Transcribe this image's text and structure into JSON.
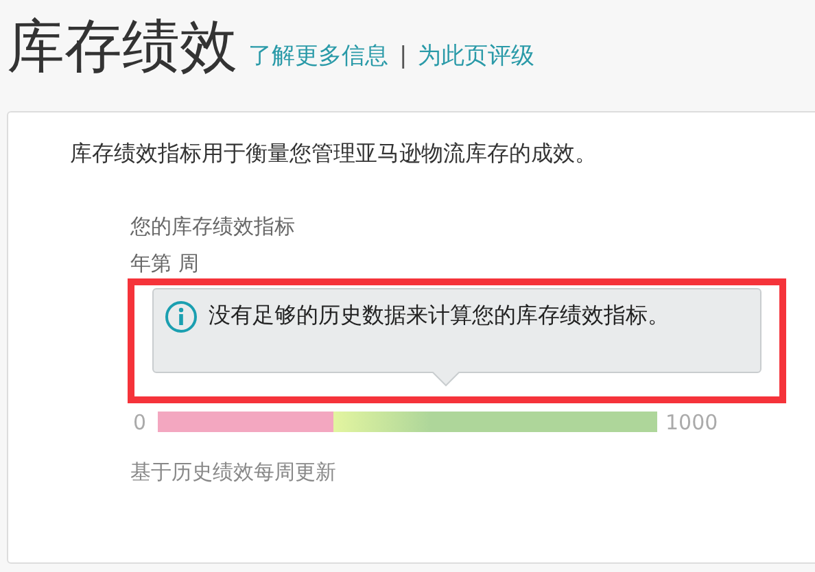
{
  "header": {
    "title": "库存绩效",
    "links": [
      "了解更多信息",
      "为此页评级"
    ],
    "separator": "|"
  },
  "card": {
    "description": "库存绩效指标用于衡量您管理亚马逊物流库存的成效。",
    "metric_label": "您的库存绩效指标",
    "period": "年第 周",
    "notice": {
      "text": "没有足够的历史数据来计算您的库存绩效指标。",
      "highlighted": true
    },
    "scale": {
      "min": "0",
      "max": "1000"
    },
    "footnote": "基于历史绩效每周更新"
  }
}
